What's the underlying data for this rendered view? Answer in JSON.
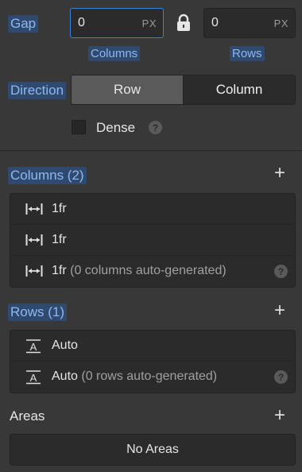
{
  "gap": {
    "label": "Gap",
    "columns_value": "0",
    "columns_unit": "PX",
    "rows_value": "0",
    "rows_unit": "PX",
    "columns_label": "Columns",
    "rows_label": "Rows"
  },
  "direction": {
    "label": "Direction",
    "options": [
      "Row",
      "Column"
    ],
    "selected": "Row"
  },
  "dense": {
    "label": "Dense",
    "checked": false,
    "help": "?"
  },
  "columns_section": {
    "title": "Columns (2)",
    "add": "+",
    "items": [
      {
        "value": "1fr",
        "note": ""
      },
      {
        "value": "1fr",
        "note": ""
      },
      {
        "value": "1fr",
        "note": "(0 columns auto-generated)",
        "help": "?"
      }
    ]
  },
  "rows_section": {
    "title": "Rows (1)",
    "add": "+",
    "items": [
      {
        "value": "Auto",
        "note": ""
      },
      {
        "value": "Auto",
        "note": "(0 rows auto-generated)",
        "help": "?"
      }
    ]
  },
  "areas_section": {
    "title": "Areas",
    "add": "+",
    "empty": "No Areas"
  },
  "colors": {
    "background": "#383838",
    "field": "#2b2b2b",
    "accent": "#3d7fe0",
    "label_highlight": "#2f4a6e"
  }
}
